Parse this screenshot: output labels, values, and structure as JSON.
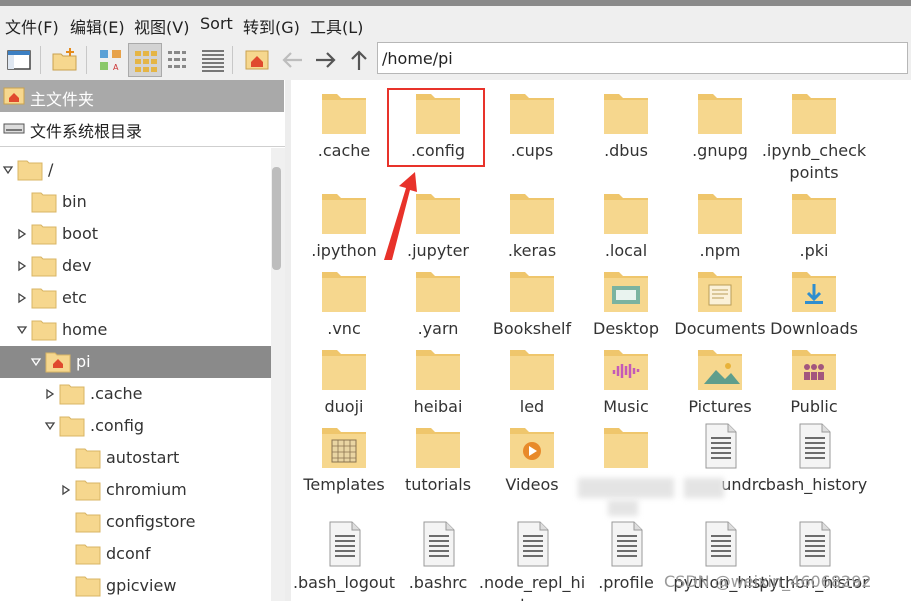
{
  "menu": [
    "文件(F)",
    "编辑(E)",
    "视图(V)",
    "Sort",
    "转到(G)",
    "工具(L)"
  ],
  "toolbar": {
    "buttons": [
      "new-window",
      "new-folder",
      "icon-view",
      "thumbnail-view",
      "compact-view",
      "list-view",
      "home",
      "back",
      "forward",
      "up"
    ],
    "path": "/home/pi"
  },
  "places": [
    {
      "label": "主文件夹",
      "icon": "home-icon"
    },
    {
      "label": "文件系统根目录",
      "icon": "drive-icon"
    }
  ],
  "tree": [
    {
      "label": "/",
      "expander": "expanded",
      "depth": 0
    },
    {
      "label": "bin",
      "expander": "none",
      "depth": 1
    },
    {
      "label": "boot",
      "expander": "collapsed",
      "depth": 1
    },
    {
      "label": "dev",
      "expander": "collapsed",
      "depth": 1
    },
    {
      "label": "etc",
      "expander": "collapsed",
      "depth": 1
    },
    {
      "label": "home",
      "expander": "expanded",
      "depth": 1
    },
    {
      "label": "pi",
      "expander": "expanded",
      "depth": 2,
      "selected": true,
      "home": true
    },
    {
      "label": ".cache",
      "expander": "collapsed",
      "depth": 3
    },
    {
      "label": ".config",
      "expander": "expanded",
      "depth": 3
    },
    {
      "label": "autostart",
      "expander": "none",
      "depth": 4
    },
    {
      "label": "chromium",
      "expander": "collapsed",
      "depth": 4
    },
    {
      "label": "configstore",
      "expander": "none",
      "depth": 4
    },
    {
      "label": "dconf",
      "expander": "none",
      "depth": 4
    },
    {
      "label": "gpicview",
      "expander": "none",
      "depth": 4
    }
  ],
  "files": [
    {
      "name": ".cache",
      "icon": "folder"
    },
    {
      "name": ".config",
      "icon": "folder",
      "highlighted": true
    },
    {
      "name": ".cups",
      "icon": "folder"
    },
    {
      "name": ".dbus",
      "icon": "folder"
    },
    {
      "name": ".gnupg",
      "icon": "folder"
    },
    {
      "name": ".ipynb_checkpoints",
      "icon": "folder"
    },
    {
      "name": ".ipython",
      "icon": "folder"
    },
    {
      "name": ".jupyter",
      "icon": "folder"
    },
    {
      "name": ".keras",
      "icon": "folder"
    },
    {
      "name": ".local",
      "icon": "folder"
    },
    {
      "name": ".npm",
      "icon": "folder"
    },
    {
      "name": ".pki",
      "icon": "folder"
    },
    {
      "name": ".vnc",
      "icon": "folder"
    },
    {
      "name": ".yarn",
      "icon": "folder"
    },
    {
      "name": "Bookshelf",
      "icon": "folder"
    },
    {
      "name": "Desktop",
      "icon": "folder-desktop"
    },
    {
      "name": "Documents",
      "icon": "folder-documents"
    },
    {
      "name": "Downloads",
      "icon": "folder-downloads"
    },
    {
      "name": "duoji",
      "icon": "folder"
    },
    {
      "name": "heibai",
      "icon": "folder"
    },
    {
      "name": "led",
      "icon": "folder"
    },
    {
      "name": "Music",
      "icon": "folder-music"
    },
    {
      "name": "Pictures",
      "icon": "folder-pictures"
    },
    {
      "name": "Public",
      "icon": "folder-public"
    },
    {
      "name": "Templates",
      "icon": "folder-templates"
    },
    {
      "name": "tutorials",
      "icon": "folder"
    },
    {
      "name": "Videos",
      "icon": "folder-videos"
    },
    {
      "name": "",
      "icon": "folder",
      "blurred": true
    },
    {
      "name": "undrc",
      "icon": "text-file",
      "blurred": true
    },
    {
      "name": ".bash_history",
      "icon": "text-file"
    },
    {
      "name": ".bash_logout",
      "icon": "text-file"
    },
    {
      "name": ".bashrc",
      "icon": "text-file"
    },
    {
      "name": ".node_repl_history",
      "icon": "text-file"
    },
    {
      "name": ".profile",
      "icon": "text-file"
    },
    {
      "name": "python_hist",
      "icon": "text-file"
    },
    {
      "name": "python_history",
      "icon": "text-file"
    }
  ],
  "watermark": "CSDN @weixin_46068292",
  "colors": {
    "folder": "#f6d78e",
    "folder_tab": "#efc66c",
    "selection": "#8a8a8a",
    "highlight": "#e8322a"
  }
}
